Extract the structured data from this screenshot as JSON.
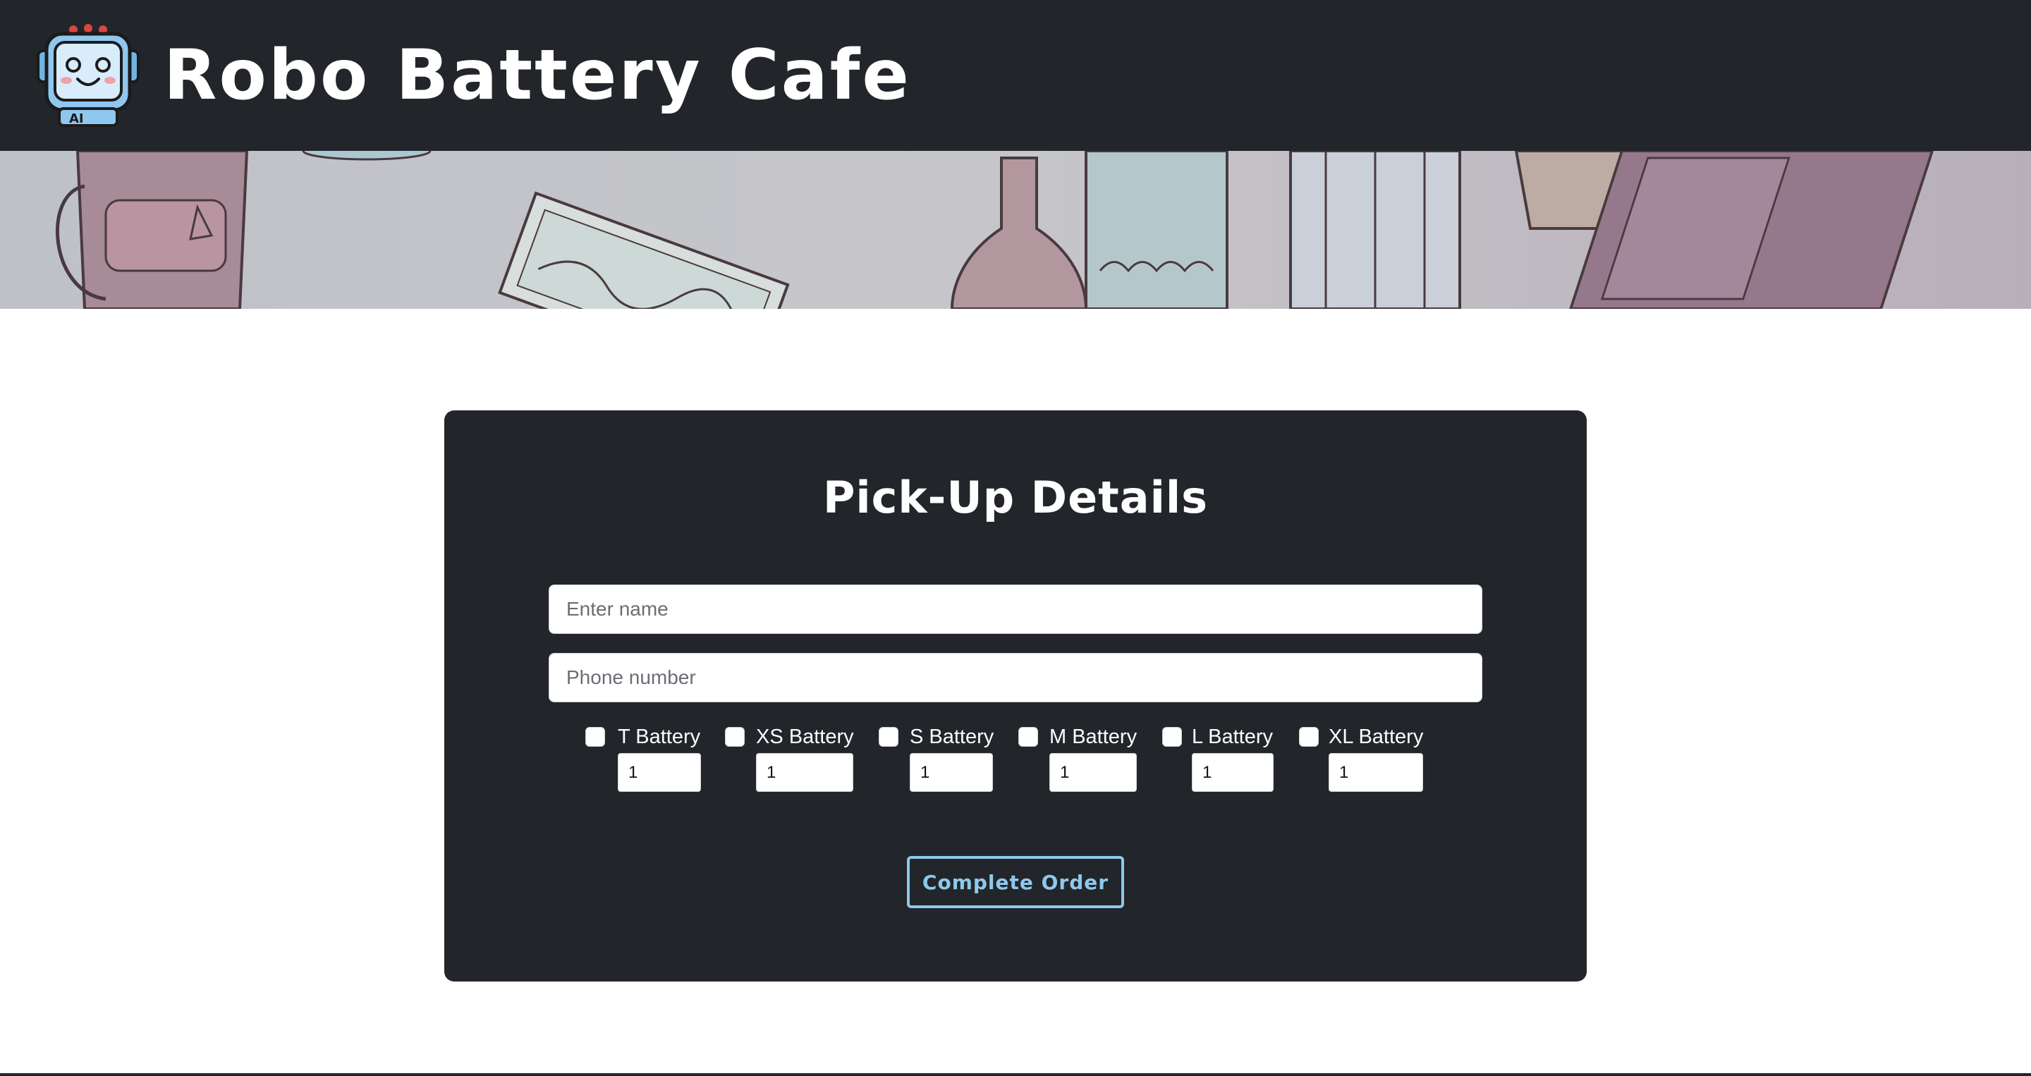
{
  "site": {
    "title": "Robo Battery Cafe",
    "logo_icon": "robot-mascot-icon",
    "logo_badge": "AI"
  },
  "banner": {
    "image": "illustrated-cafe-table-banner"
  },
  "form": {
    "title": "Pick-Up Details",
    "name_placeholder": "Enter name",
    "phone_placeholder": "Phone number",
    "batteries": [
      {
        "label": "T Battery",
        "checked": false,
        "quantity": "1"
      },
      {
        "label": "XS Battery",
        "checked": false,
        "quantity": "1"
      },
      {
        "label": "S Battery",
        "checked": false,
        "quantity": "1"
      },
      {
        "label": "M Battery",
        "checked": false,
        "quantity": "1"
      },
      {
        "label": "L Battery",
        "checked": false,
        "quantity": "1"
      },
      {
        "label": "XL Battery",
        "checked": false,
        "quantity": "1"
      }
    ],
    "submit_label": "Complete Order"
  },
  "colors": {
    "header_bg": "#222529",
    "card_bg": "#222529",
    "accent": "#8ec9ec",
    "page_bg": "#ffffff"
  }
}
